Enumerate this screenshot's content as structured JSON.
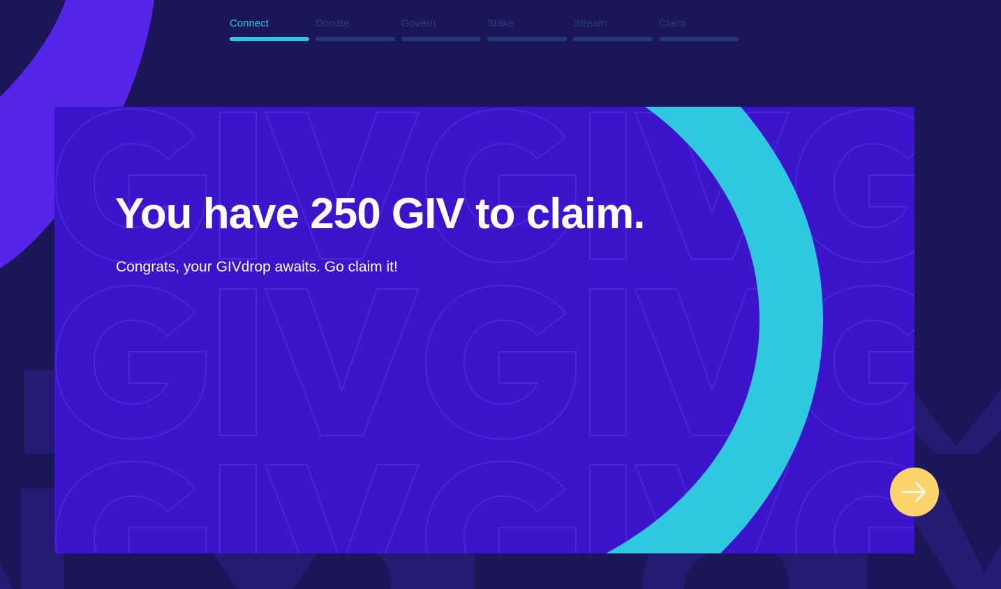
{
  "stepper": {
    "steps": [
      {
        "label": "Connect",
        "active": true
      },
      {
        "label": "Donate",
        "active": false
      },
      {
        "label": "Govern",
        "active": false
      },
      {
        "label": "Stake",
        "active": false
      },
      {
        "label": "Stream",
        "active": false
      },
      {
        "label": "Claim",
        "active": false
      }
    ]
  },
  "card": {
    "title": "You have 250 GIV to claim.",
    "subtitle": "Congrats, your GIVdrop awaits. Go claim it!"
  },
  "next_button": {
    "icon": "arrow-right-icon"
  },
  "colors": {
    "page_background": "#1b1657",
    "card_background": "#3b14cc",
    "accent_cyan": "#2fc8e0",
    "accent_purple": "#5526ea",
    "button_yellow": "#fcd46b",
    "inactive_step": "#253a7a",
    "text_white": "#ffffff"
  }
}
